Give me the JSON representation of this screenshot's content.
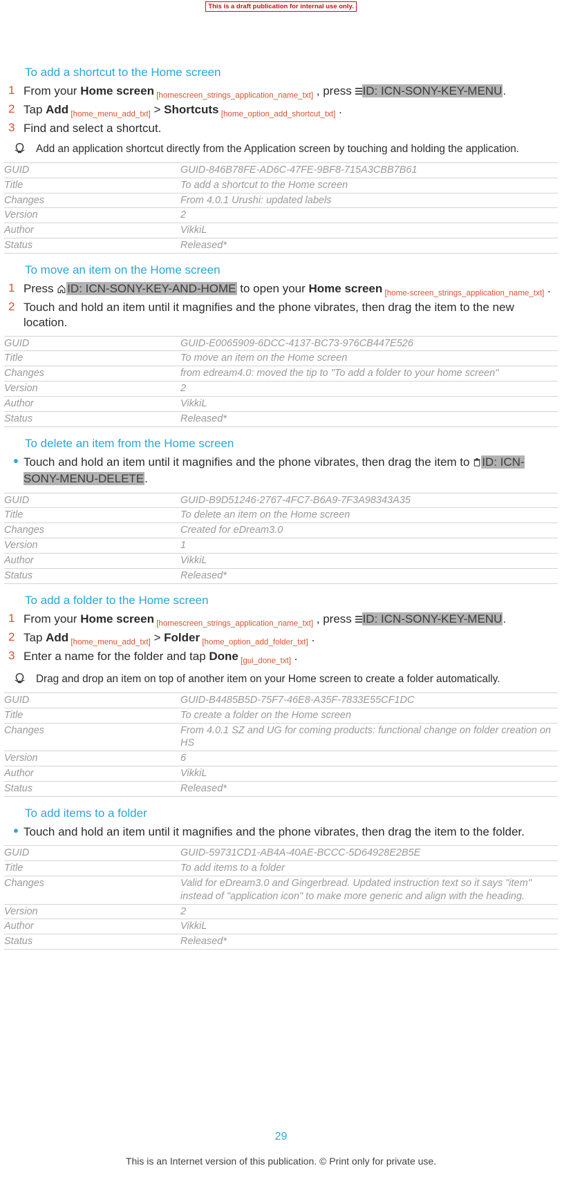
{
  "banner": "This is a draft publication for internal use only.",
  "page_number": "29",
  "footer_disclaimer": "This is an Internet version of this publication. © Print only for private use.",
  "labels": {
    "guid": "GUID",
    "title": "Title",
    "changes": "Changes",
    "version": "Version",
    "author": "Author",
    "status": "Status"
  },
  "section1": {
    "heading": "To add a shortcut to the Home screen",
    "step1_a": "From your ",
    "step1_b": "Home screen",
    "step1_tag1": " [homescreen_strings_application_name_txt]",
    "step1_c": " , press ",
    "step1_hi": "ID: ICN-SONY-KEY-MENU",
    "step1_d": ".",
    "step2_a": "Tap ",
    "step2_b": "Add",
    "step2_tag1": " [home_menu_add_txt]",
    "step2_c": " > ",
    "step2_d": "Shortcuts",
    "step2_tag2": " [home_option_add_shortcut_txt]",
    "step2_e": " .",
    "step3": "Find and select a shortcut.",
    "tip": "Add an application shortcut directly from the Application screen by touching and holding the application.",
    "meta": {
      "guid": "GUID-846B78FE-AD6C-47FE-9BF8-715A3CBB7B61",
      "title": "To add a shortcut to the Home screen",
      "changes": "From 4.0.1 Urushi: updated labels",
      "version": "2",
      "author": "VikkiL",
      "status": "Released*"
    }
  },
  "section2": {
    "heading": "To move an item on the Home screen",
    "step1_a": "Press ",
    "step1_hi": "ID: ICN-SONY-KEY-AND-HOME",
    "step1_b": " to open your ",
    "step1_c": "Home screen",
    "step1_tag1": " [home-screen_strings_application_name_txt]",
    "step1_d": " .",
    "step2": "Touch and hold an item until it magnifies and the phone vibrates, then drag the item to the new location.",
    "meta": {
      "guid": "GUID-E0065909-6DCC-4137-BC73-976CB447E526",
      "title": "To move an item on the Home screen",
      "changes": "from edream4.0: moved the tip to \"To add a folder to your home screen\"",
      "version": "2",
      "author": "VikkiL",
      "status": "Released*"
    }
  },
  "section3": {
    "heading": "To delete an item from the Home screen",
    "bullet_a": "Touch and hold an item until it magnifies and the phone vibrates, then drag the item to ",
    "bullet_hi": "ID: ICN-SONY-MENU-DELETE",
    "bullet_b": ".",
    "meta": {
      "guid": "GUID-B9D51246-2767-4FC7-B6A9-7F3A98343A35",
      "title": "To delete an item on the Home screen",
      "changes": "Created for eDream3.0",
      "version": "1",
      "author": "VikkiL",
      "status": "Released*"
    }
  },
  "section4": {
    "heading": "To add a folder to the Home screen",
    "step1_a": "From your ",
    "step1_b": "Home screen",
    "step1_tag1": " [homescreen_strings_application_name_txt]",
    "step1_c": " , press ",
    "step1_hi": "ID: ICN-SONY-KEY-MENU",
    "step1_d": ".",
    "step2_a": "Tap ",
    "step2_b": "Add",
    "step2_tag1": " [home_menu_add_txt]",
    "step2_c": " > ",
    "step2_d": "Folder",
    "step2_tag2": " [home_option_add_folder_txt]",
    "step2_e": " .",
    "step3_a": "Enter a name for the folder and tap ",
    "step3_b": "Done",
    "step3_tag1": " [gui_done_txt]",
    "step3_c": " .",
    "tip": "Drag and drop an item on top of another item on your Home screen to create a folder automatically.",
    "meta": {
      "guid": "GUID-B4485B5D-75F7-46E8-A35F-7833E55CF1DC",
      "title": "To create a folder on the Home screen",
      "changes": "From 4.0.1 SZ and UG for coming products: functional change on folder creation on HS",
      "version": "6",
      "author": "VikkiL",
      "status": "Released*"
    }
  },
  "section5": {
    "heading": "To add items to a folder",
    "bullet": "Touch and hold an item until it magnifies and the phone vibrates, then drag the item to the folder.",
    "meta": {
      "guid": "GUID-59731CD1-AB4A-40AE-BCCC-5D64928E2B5E",
      "title": "To add items to a folder",
      "changes": "Valid for eDream3.0 and Gingerbread. Updated instruction text so it says \"item\" instead of \"application icon\" to make more generic and align with the heading.",
      "version": "2",
      "author": "VikkiL",
      "status": "Released*"
    }
  }
}
